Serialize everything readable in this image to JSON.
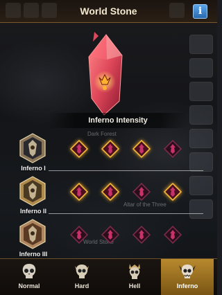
{
  "header": {
    "title": "World Stone",
    "info_label": "i"
  },
  "panel": {
    "title": "Inferno Intensity"
  },
  "tiers": [
    {
      "label": "Inferno I",
      "gems_lit": [
        true,
        true,
        true,
        false
      ]
    },
    {
      "label": "Inferno II",
      "gems_lit": [
        true,
        true,
        false,
        true
      ]
    },
    {
      "label": "Inferno III",
      "gems_lit": [
        false,
        false,
        false,
        false
      ]
    }
  ],
  "background_text": [
    "Dark Forest",
    "Altar of the Three",
    "World Stone"
  ],
  "tabs": [
    {
      "label": "Normal",
      "active": false
    },
    {
      "label": "Hard",
      "active": false
    },
    {
      "label": "Hell",
      "active": false
    },
    {
      "label": "Inferno",
      "active": true
    }
  ],
  "colors": {
    "accent_gold": "#e0a63a",
    "gem_red": "#c8326a",
    "crystal": "#e0485a"
  }
}
